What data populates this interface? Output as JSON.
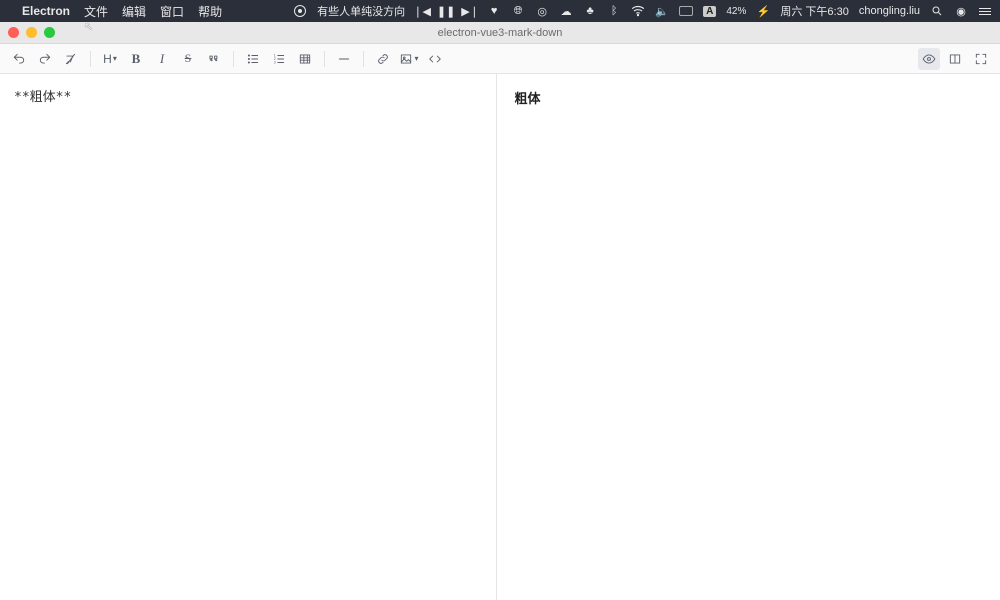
{
  "menubar": {
    "app_name": "Electron",
    "items": [
      "文件",
      "编辑",
      "窗口",
      "帮助"
    ],
    "now_playing": "有些人单纯没方向",
    "battery_percent": "42%",
    "clock": "周六 下午6:30",
    "user": "chongling.liu",
    "input_indicator": "A"
  },
  "window": {
    "title": "electron-vue3-mark-down"
  },
  "toolbar": {
    "heading_label": "H"
  },
  "editor": {
    "source": "**粗体**"
  },
  "preview": {
    "rendered": "粗体"
  }
}
